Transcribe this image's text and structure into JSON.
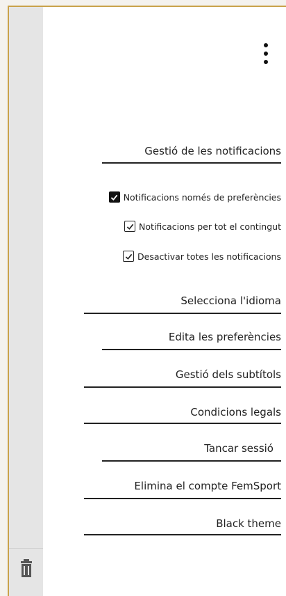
{
  "menu": {
    "notifications_header": "Gestió de les notificacions",
    "notification_options": [
      {
        "label": "Notificacions només de preferències",
        "checked": true,
        "style": "filled"
      },
      {
        "label": "Notificacions per tot el contingut",
        "checked": true,
        "style": "outlined"
      },
      {
        "label": "Desactivar totes les notificacions",
        "checked": true,
        "style": "outlined"
      }
    ],
    "items": [
      {
        "label": "Selecciona l'idioma"
      },
      {
        "label": "Edita les preferències"
      },
      {
        "label": "Gestió dels subtítols"
      },
      {
        "label": "Condicions legals"
      },
      {
        "label": "Tancar sessió"
      },
      {
        "label": "Elimina el compte FemSport"
      },
      {
        "label": "Black theme"
      }
    ]
  },
  "icons": {
    "more": "more-vertical-icon",
    "sidebar": "trash-icon"
  },
  "colors": {
    "frame_accent": "#c9a24a",
    "side_strip": "#e5e5e5",
    "text": "#222222"
  }
}
